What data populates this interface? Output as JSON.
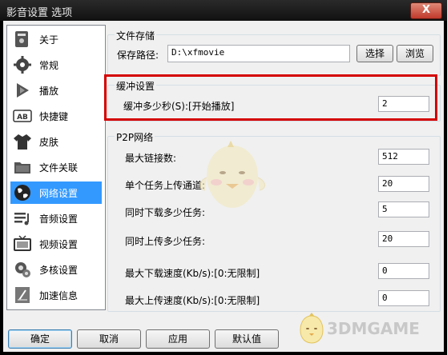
{
  "window": {
    "title": "影音设置 选项",
    "close_label": "X"
  },
  "sidebar": {
    "items": [
      {
        "label": "关于",
        "icon": "info-icon",
        "selected": false
      },
      {
        "label": "常规",
        "icon": "gear-icon",
        "selected": false
      },
      {
        "label": "播放",
        "icon": "play-icon",
        "selected": false
      },
      {
        "label": "快捷键",
        "icon": "keyboard-icon",
        "selected": false
      },
      {
        "label": "皮肤",
        "icon": "shirt-icon",
        "selected": false
      },
      {
        "label": "文件关联",
        "icon": "folder-icon",
        "selected": false
      },
      {
        "label": "网络设置",
        "icon": "globe-icon",
        "selected": true
      },
      {
        "label": "音频设置",
        "icon": "audio-icon",
        "selected": false
      },
      {
        "label": "视频设置",
        "icon": "video-icon",
        "selected": false
      },
      {
        "label": "多核设置",
        "icon": "multicore-icon",
        "selected": false
      },
      {
        "label": "加速信息",
        "icon": "accel-icon",
        "selected": false
      }
    ]
  },
  "file_storage": {
    "title": "文件存储",
    "path_label": "保存路径:",
    "path_value": "D:\\xfmovie",
    "choose_button": "选择",
    "browse_button": "浏览"
  },
  "buffer": {
    "title": "缓冲设置",
    "seconds_label": "缓冲多少秒(S):[开始播放]",
    "seconds_value": "2"
  },
  "p2p": {
    "title": "P2P网络",
    "max_connections_label": "最大链接数:",
    "max_connections_value": "512",
    "upload_channels_label": "单个任务上传通道:",
    "upload_channels_value": "20",
    "concurrent_downloads_label": "同时下载多少任务:",
    "concurrent_downloads_value": "5",
    "concurrent_uploads_label": "同时上传多少任务:",
    "concurrent_uploads_value": "20",
    "max_download_label": "最大下载速度(Kb/s):[0:无限制]",
    "max_download_value": "0",
    "max_upload_label": "最大上传速度(Kb/s):[0:无限制]",
    "max_upload_value": "0"
  },
  "footer": {
    "ok": "确定",
    "cancel": "取消",
    "apply": "应用",
    "default": "默认值"
  },
  "watermark": {
    "text": "3DMGAME"
  },
  "colors": {
    "selection": "#3399ff",
    "highlight_border": "#d40000"
  }
}
